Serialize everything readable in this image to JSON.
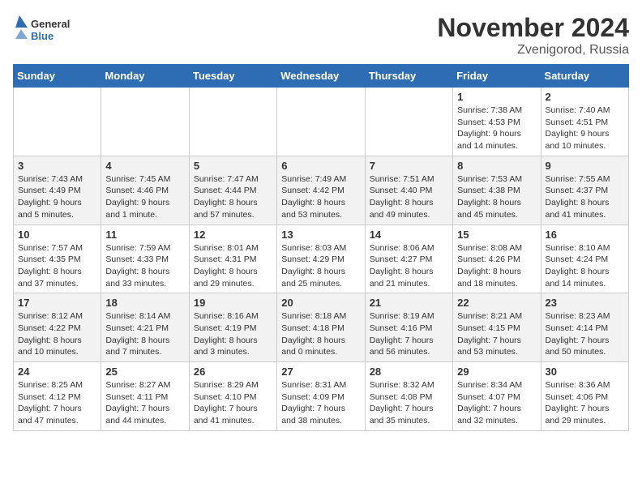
{
  "header": {
    "logo_general": "General",
    "logo_blue": "Blue",
    "month_title": "November 2024",
    "location": "Zvenigorod, Russia"
  },
  "days_of_week": [
    "Sunday",
    "Monday",
    "Tuesday",
    "Wednesday",
    "Thursday",
    "Friday",
    "Saturday"
  ],
  "weeks": [
    [
      {
        "day": "",
        "info": ""
      },
      {
        "day": "",
        "info": ""
      },
      {
        "day": "",
        "info": ""
      },
      {
        "day": "",
        "info": ""
      },
      {
        "day": "",
        "info": ""
      },
      {
        "day": "1",
        "info": "Sunrise: 7:38 AM\nSunset: 4:53 PM\nDaylight: 9 hours and 14 minutes."
      },
      {
        "day": "2",
        "info": "Sunrise: 7:40 AM\nSunset: 4:51 PM\nDaylight: 9 hours and 10 minutes."
      }
    ],
    [
      {
        "day": "3",
        "info": "Sunrise: 7:43 AM\nSunset: 4:49 PM\nDaylight: 9 hours and 5 minutes."
      },
      {
        "day": "4",
        "info": "Sunrise: 7:45 AM\nSunset: 4:46 PM\nDaylight: 9 hours and 1 minute."
      },
      {
        "day": "5",
        "info": "Sunrise: 7:47 AM\nSunset: 4:44 PM\nDaylight: 8 hours and 57 minutes."
      },
      {
        "day": "6",
        "info": "Sunrise: 7:49 AM\nSunset: 4:42 PM\nDaylight: 8 hours and 53 minutes."
      },
      {
        "day": "7",
        "info": "Sunrise: 7:51 AM\nSunset: 4:40 PM\nDaylight: 8 hours and 49 minutes."
      },
      {
        "day": "8",
        "info": "Sunrise: 7:53 AM\nSunset: 4:38 PM\nDaylight: 8 hours and 45 minutes."
      },
      {
        "day": "9",
        "info": "Sunrise: 7:55 AM\nSunset: 4:37 PM\nDaylight: 8 hours and 41 minutes."
      }
    ],
    [
      {
        "day": "10",
        "info": "Sunrise: 7:57 AM\nSunset: 4:35 PM\nDaylight: 8 hours and 37 minutes."
      },
      {
        "day": "11",
        "info": "Sunrise: 7:59 AM\nSunset: 4:33 PM\nDaylight: 8 hours and 33 minutes."
      },
      {
        "day": "12",
        "info": "Sunrise: 8:01 AM\nSunset: 4:31 PM\nDaylight: 8 hours and 29 minutes."
      },
      {
        "day": "13",
        "info": "Sunrise: 8:03 AM\nSunset: 4:29 PM\nDaylight: 8 hours and 25 minutes."
      },
      {
        "day": "14",
        "info": "Sunrise: 8:06 AM\nSunset: 4:27 PM\nDaylight: 8 hours and 21 minutes."
      },
      {
        "day": "15",
        "info": "Sunrise: 8:08 AM\nSunset: 4:26 PM\nDaylight: 8 hours and 18 minutes."
      },
      {
        "day": "16",
        "info": "Sunrise: 8:10 AM\nSunset: 4:24 PM\nDaylight: 8 hours and 14 minutes."
      }
    ],
    [
      {
        "day": "17",
        "info": "Sunrise: 8:12 AM\nSunset: 4:22 PM\nDaylight: 8 hours and 10 minutes."
      },
      {
        "day": "18",
        "info": "Sunrise: 8:14 AM\nSunset: 4:21 PM\nDaylight: 8 hours and 7 minutes."
      },
      {
        "day": "19",
        "info": "Sunrise: 8:16 AM\nSunset: 4:19 PM\nDaylight: 8 hours and 3 minutes."
      },
      {
        "day": "20",
        "info": "Sunrise: 8:18 AM\nSunset: 4:18 PM\nDaylight: 8 hours and 0 minutes."
      },
      {
        "day": "21",
        "info": "Sunrise: 8:19 AM\nSunset: 4:16 PM\nDaylight: 7 hours and 56 minutes."
      },
      {
        "day": "22",
        "info": "Sunrise: 8:21 AM\nSunset: 4:15 PM\nDaylight: 7 hours and 53 minutes."
      },
      {
        "day": "23",
        "info": "Sunrise: 8:23 AM\nSunset: 4:14 PM\nDaylight: 7 hours and 50 minutes."
      }
    ],
    [
      {
        "day": "24",
        "info": "Sunrise: 8:25 AM\nSunset: 4:12 PM\nDaylight: 7 hours and 47 minutes."
      },
      {
        "day": "25",
        "info": "Sunrise: 8:27 AM\nSunset: 4:11 PM\nDaylight: 7 hours and 44 minutes."
      },
      {
        "day": "26",
        "info": "Sunrise: 8:29 AM\nSunset: 4:10 PM\nDaylight: 7 hours and 41 minutes."
      },
      {
        "day": "27",
        "info": "Sunrise: 8:31 AM\nSunset: 4:09 PM\nDaylight: 7 hours and 38 minutes."
      },
      {
        "day": "28",
        "info": "Sunrise: 8:32 AM\nSunset: 4:08 PM\nDaylight: 7 hours and 35 minutes."
      },
      {
        "day": "29",
        "info": "Sunrise: 8:34 AM\nSunset: 4:07 PM\nDaylight: 7 hours and 32 minutes."
      },
      {
        "day": "30",
        "info": "Sunrise: 8:36 AM\nSunset: 4:06 PM\nDaylight: 7 hours and 29 minutes."
      }
    ]
  ]
}
